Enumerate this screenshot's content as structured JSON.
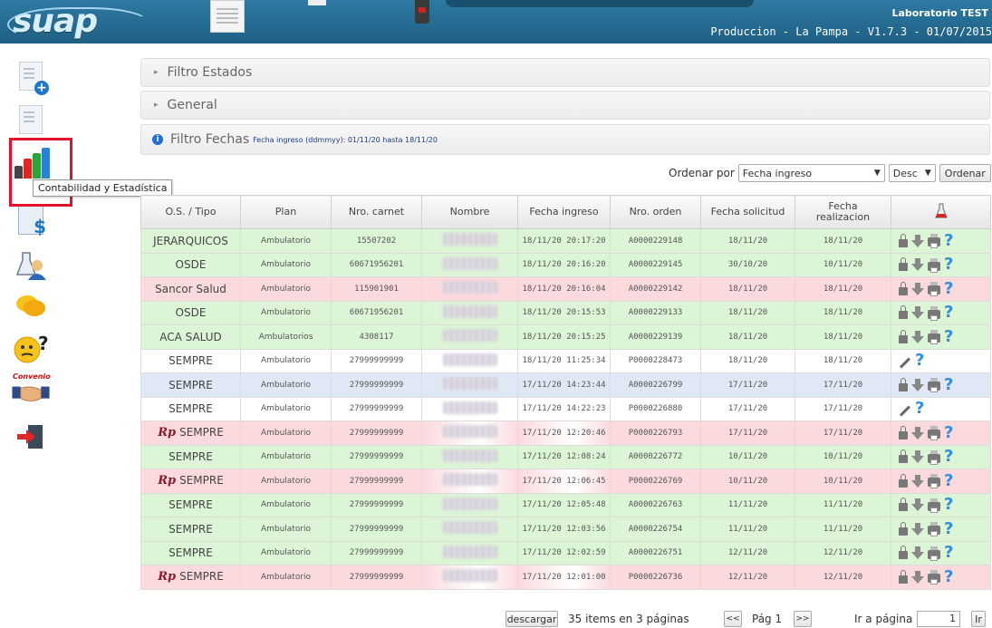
{
  "header": {
    "logo": "suap",
    "lab_name": "Laboratorio TEST",
    "env": "Produccion - La Pampa - V1.7.3 - 01/07/2015"
  },
  "sidebar": {
    "tooltip": "Contabilidad y Estadística",
    "convenio_label": "Convenio"
  },
  "panels": {
    "estados": "Filtro Estados",
    "general": "General",
    "fechas": "Filtro Fechas",
    "fechas_sub": "Fecha ingreso (ddmmyy): 01/11/20 hasta 18/11/20"
  },
  "sort": {
    "label": "Ordenar por",
    "field": "Fecha ingreso",
    "direction": "Desc",
    "button": "Ordenar"
  },
  "table": {
    "headers": [
      "O.S. / Tipo",
      "Plan",
      "Nro. carnet",
      "Nombre",
      "Fecha ingreso",
      "Nro. orden",
      "Fecha solicitud",
      "Fecha realizacion"
    ],
    "rows": [
      {
        "os": "JERARQUICOS",
        "plan": "Ambulatorio",
        "carnet": "15507202",
        "ingreso": "18/11/20 20:17:20",
        "orden": "A0000229148",
        "solicitud": "18/11/20",
        "realizacion": "18/11/20",
        "color": "green",
        "rp": false,
        "actions": "full"
      },
      {
        "os": "OSDE",
        "plan": "Ambulatorio",
        "carnet": "60671956201",
        "ingreso": "18/11/20 20:16:20",
        "orden": "A0000229145",
        "solicitud": "30/10/20",
        "realizacion": "10/11/20",
        "color": "green",
        "rp": false,
        "actions": "full"
      },
      {
        "os": "Sancor Salud",
        "plan": "Ambulatorio",
        "carnet": "115901901",
        "ingreso": "18/11/20 20:16:04",
        "orden": "A0000229142",
        "solicitud": "18/11/20",
        "realizacion": "18/11/20",
        "color": "pink",
        "rp": false,
        "actions": "full"
      },
      {
        "os": "OSDE",
        "plan": "Ambulatorio",
        "carnet": "60671956201",
        "ingreso": "18/11/20 20:15:53",
        "orden": "A0000229133",
        "solicitud": "18/11/20",
        "realizacion": "18/11/20",
        "color": "green",
        "rp": false,
        "actions": "full"
      },
      {
        "os": "ACA SALUD",
        "plan": "Ambulatorios",
        "carnet": "4308117",
        "ingreso": "18/11/20 20:15:25",
        "orden": "A0000229139",
        "solicitud": "18/11/20",
        "realizacion": "18/11/20",
        "color": "green",
        "rp": false,
        "actions": "full"
      },
      {
        "os": "SEMPRE",
        "plan": "Ambulatorio",
        "carnet": "27999999999",
        "ingreso": "18/11/20 11:25:34",
        "orden": "P0000228473",
        "solicitud": "18/11/20",
        "realizacion": "18/11/20",
        "color": "white",
        "rp": false,
        "actions": "edit"
      },
      {
        "os": "SEMPRE",
        "plan": "Ambulatorio",
        "carnet": "27999999999",
        "ingreso": "17/11/20 14:23:44",
        "orden": "A0000226799",
        "solicitud": "17/11/20",
        "realizacion": "17/11/20",
        "color": "blue",
        "rp": false,
        "actions": "full"
      },
      {
        "os": "SEMPRE",
        "plan": "Ambulatorio",
        "carnet": "27999999999",
        "ingreso": "17/11/20 14:22:23",
        "orden": "P0000226880",
        "solicitud": "17/11/20",
        "realizacion": "17/11/20",
        "color": "white",
        "rp": false,
        "actions": "edit"
      },
      {
        "os": "SEMPRE",
        "plan": "Ambulatorio",
        "carnet": "27999999999",
        "ingreso": "17/11/20 12:20:46",
        "orden": "P0000226793",
        "solicitud": "17/11/20",
        "realizacion": "17/11/20",
        "color": "rp-row",
        "rp": true,
        "actions": "full"
      },
      {
        "os": "SEMPRE",
        "plan": "Ambulatorio",
        "carnet": "27999999999",
        "ingreso": "17/11/20 12:08:24",
        "orden": "A0000226772",
        "solicitud": "10/11/20",
        "realizacion": "10/11/20",
        "color": "green",
        "rp": false,
        "actions": "full"
      },
      {
        "os": "SEMPRE",
        "plan": "Ambulatorio",
        "carnet": "27999999999",
        "ingreso": "17/11/20 12:06:45",
        "orden": "P0000226769",
        "solicitud": "10/11/20",
        "realizacion": "10/11/20",
        "color": "rp-row",
        "rp": true,
        "actions": "full"
      },
      {
        "os": "SEMPRE",
        "plan": "Ambulatorio",
        "carnet": "27999999999",
        "ingreso": "17/11/20 12:05:48",
        "orden": "A0000226763",
        "solicitud": "11/11/20",
        "realizacion": "11/11/20",
        "color": "green",
        "rp": false,
        "actions": "full"
      },
      {
        "os": "SEMPRE",
        "plan": "Ambulatorio",
        "carnet": "27999999999",
        "ingreso": "17/11/20 12:03:56",
        "orden": "A0000226754",
        "solicitud": "11/11/20",
        "realizacion": "11/11/20",
        "color": "green",
        "rp": false,
        "actions": "full"
      },
      {
        "os": "SEMPRE",
        "plan": "Ambulatorio",
        "carnet": "27999999999",
        "ingreso": "17/11/20 12:02:59",
        "orden": "A0000226751",
        "solicitud": "12/11/20",
        "realizacion": "12/11/20",
        "color": "green",
        "rp": false,
        "actions": "full"
      },
      {
        "os": "SEMPRE",
        "plan": "Ambulatorio",
        "carnet": "27999999999",
        "ingreso": "17/11/20 12:01:00",
        "orden": "P0000226736",
        "solicitud": "12/11/20",
        "realizacion": "12/11/20",
        "color": "rp-row",
        "rp": true,
        "actions": "full"
      }
    ]
  },
  "footer": {
    "download": "descargar",
    "items_text": "35 items en 3 páginas",
    "prev": "<<",
    "page_text": "Pág 1",
    "next": ">>",
    "goto_label": "Ir a página",
    "goto_value": "1",
    "goto_button": "Ir"
  },
  "colors": {
    "header": "#1f5f84",
    "green_row": "#dcf5d6",
    "pink_row": "#fadadd",
    "blue_row": "#e0e8f5",
    "highlight": "#e3112b"
  }
}
